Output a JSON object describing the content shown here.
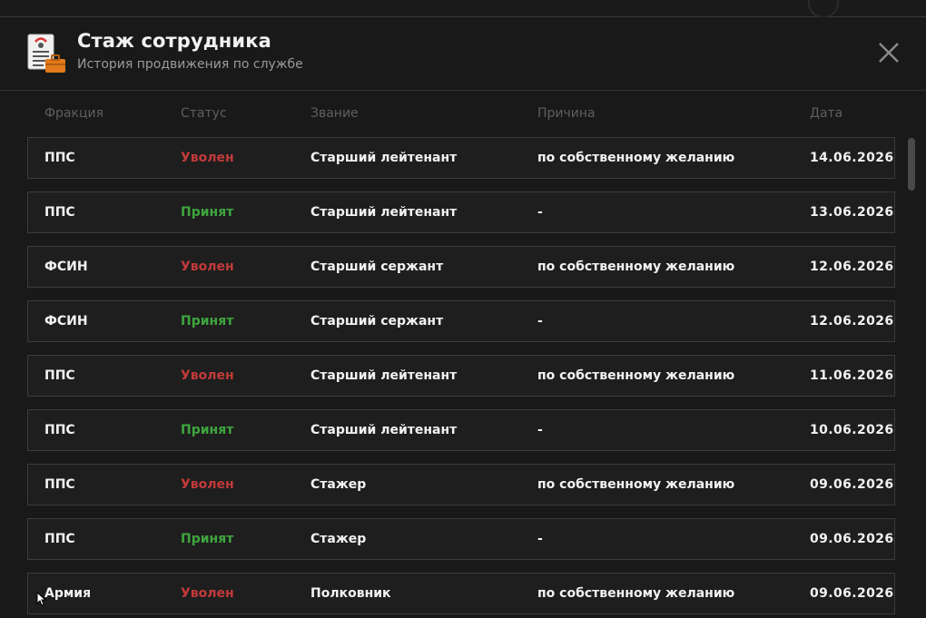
{
  "header": {
    "title": "Стаж сотрудника",
    "subtitle": "История продвижения по службе",
    "icon": "document-briefcase-icon",
    "close_icon": "close-icon"
  },
  "columns": {
    "faction": "Фракция",
    "status": "Статус",
    "rank": "Звание",
    "reason": "Причина",
    "date": "Дата"
  },
  "colors": {
    "fired": "#c13a3a",
    "hired": "#3ea53e",
    "background": "#191919"
  },
  "rows": [
    {
      "faction": "ППС",
      "status": "Уволен",
      "rank": "Старший лейтенант",
      "reason": "по собственному желанию",
      "date": "14.06.2026"
    },
    {
      "faction": "ППС",
      "status": "Принят",
      "rank": "Старший лейтенант",
      "reason": "-",
      "date": "13.06.2026"
    },
    {
      "faction": "ФСИН",
      "status": "Уволен",
      "rank": "Старший сержант",
      "reason": "по собственному желанию",
      "date": "12.06.2026"
    },
    {
      "faction": "ФСИН",
      "status": "Принят",
      "rank": "Старший сержант",
      "reason": "-",
      "date": "12.06.2026"
    },
    {
      "faction": "ППС",
      "status": "Уволен",
      "rank": "Старший лейтенант",
      "reason": "по собственному желанию",
      "date": "11.06.2026"
    },
    {
      "faction": "ППС",
      "status": "Принят",
      "rank": "Старший лейтенант",
      "reason": "-",
      "date": "10.06.2026"
    },
    {
      "faction": "ППС",
      "status": "Уволен",
      "rank": "Стажер",
      "reason": "по собственному желанию",
      "date": "09.06.2026"
    },
    {
      "faction": "ППС",
      "status": "Принят",
      "rank": "Стажер",
      "reason": "-",
      "date": "09.06.2026"
    },
    {
      "faction": "Армия",
      "status": "Уволен",
      "rank": "Полковник",
      "reason": "по собственному желанию",
      "date": "09.06.2026"
    }
  ]
}
